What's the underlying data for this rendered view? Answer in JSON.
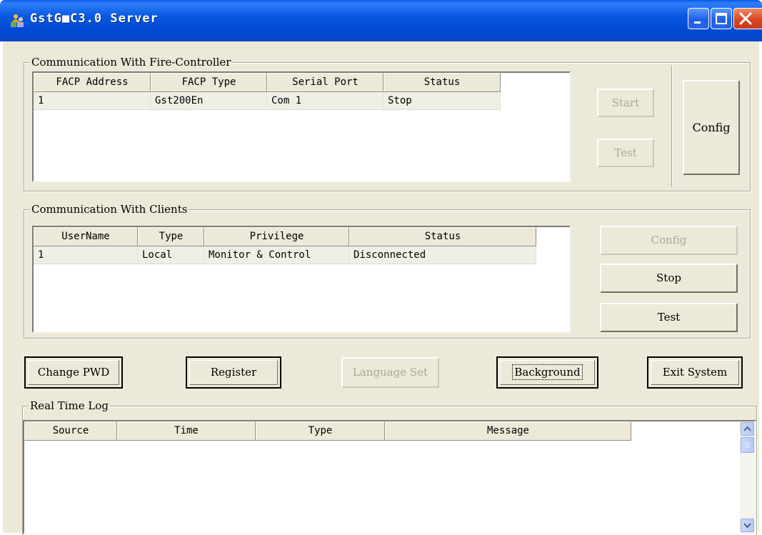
{
  "window": {
    "title": "GstG■C3.0 Server"
  },
  "fire_controller": {
    "legend": "Communication With Fire-Controller",
    "columns": [
      "FACP Address",
      "FACP Type",
      "Serial Port",
      "Status"
    ],
    "rows": [
      [
        "1",
        "Gst200En",
        "Com 1",
        "Stop"
      ]
    ],
    "buttons": {
      "start": "Start",
      "test": "Test",
      "config": "Config"
    }
  },
  "clients": {
    "legend": "Communication With Clients",
    "columns": [
      "UserName",
      "Type",
      "Privilege",
      "Status"
    ],
    "rows": [
      [
        "1",
        "Local",
        "Monitor & Control",
        "Disconnected"
      ]
    ],
    "buttons": {
      "config": "Config",
      "stop": "Stop",
      "test": "Test"
    }
  },
  "toolbar": {
    "change_pwd": "Change PWD",
    "register": "Register",
    "language_set": "Language Set",
    "background": "Background",
    "exit_system": "Exit System"
  },
  "log": {
    "legend": "Real Time Log",
    "columns": [
      "Source",
      "Time",
      "Type",
      "Message"
    ]
  },
  "colors": {
    "titlebar": "#0058e6",
    "window_bg": "#ece9d8",
    "close_button": "#d9461f"
  }
}
